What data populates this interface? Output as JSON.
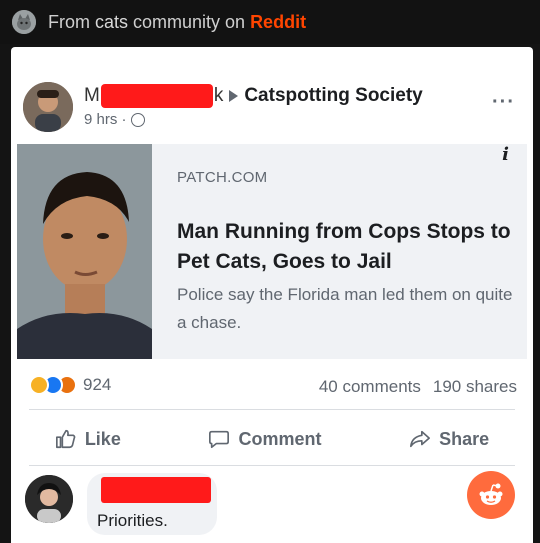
{
  "topbar": {
    "prefix": "From ",
    "community": "cats",
    "middle": " community on ",
    "brand": "Reddit"
  },
  "post": {
    "name_start": "M",
    "name_end": "k",
    "group": "Catspotting Society",
    "time": "9 hrs · ",
    "more": "···"
  },
  "link": {
    "source": "PATCH.COM",
    "title": "Man Running from Cops Stops to Pet Cats, Goes to Jail",
    "description": "Police say the Florida man led them on quite a chase.",
    "info": "i"
  },
  "stats": {
    "reaction_count": "924",
    "comments": "40 comments",
    "shares": "190 shares"
  },
  "actions": {
    "like": "Like",
    "comment": "Comment",
    "share": "Share"
  },
  "comment": {
    "text": "Priorities."
  },
  "colors": {
    "reddit_orange": "#ff4500",
    "redaction_red": "#ff1a1a",
    "facebook_blue": "#1877f2"
  }
}
